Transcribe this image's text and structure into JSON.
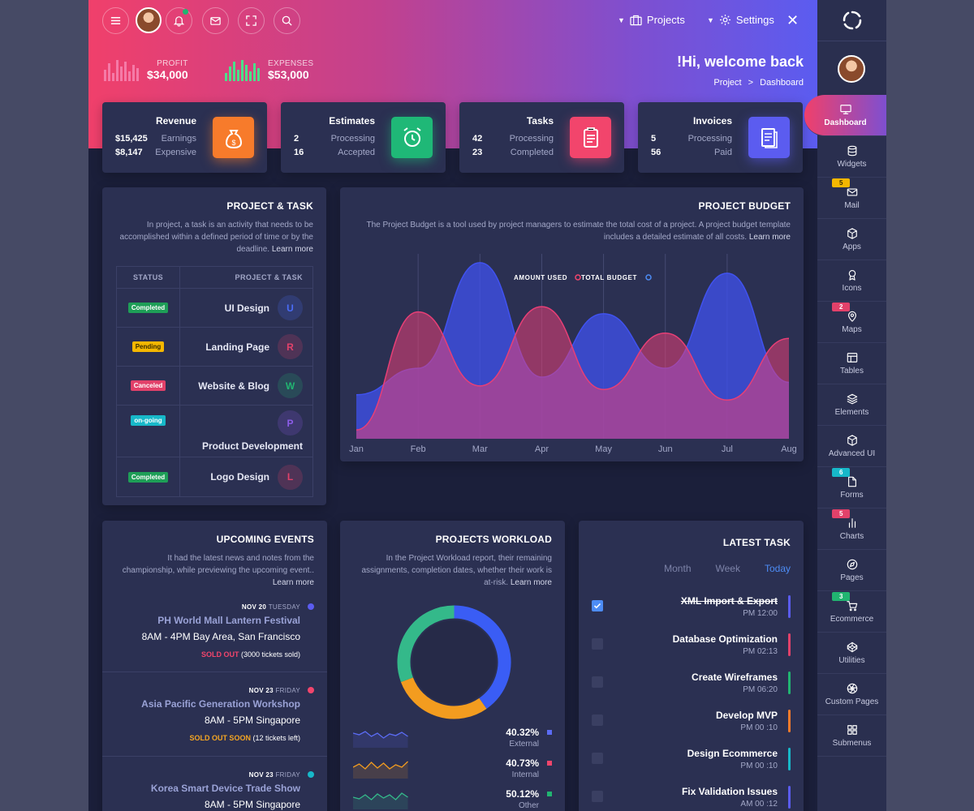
{
  "header": {
    "projects_label": "Projects",
    "settings_label": "Settings"
  },
  "stats": {
    "profit": {
      "label": "PROFIT",
      "value": "$34,000"
    },
    "expenses": {
      "label": "EXPENSES",
      "value": "$53,000"
    }
  },
  "welcome": {
    "title": "!Hi, welcome back",
    "crumb_1": "Project",
    "crumb_sep": ">",
    "crumb_2": "Dashboard"
  },
  "kpis": [
    {
      "title": "Revenue",
      "r1v": "$15,425",
      "r1l": "Earnings",
      "r2v": "$8,147",
      "r2l": "Expensive",
      "icon": "money-bag-icon",
      "color": "#f77b2b"
    },
    {
      "title": "Estimates",
      "r1v": "2",
      "r1l": "Processing",
      "r2v": "16",
      "r2l": "Accepted",
      "icon": "alarm-clock-icon",
      "color": "#1fb877"
    },
    {
      "title": "Tasks",
      "r1v": "42",
      "r1l": "Processing",
      "r2v": "23",
      "r2l": "Completed",
      "icon": "clipboard-icon",
      "color": "#f2456c"
    },
    {
      "title": "Invoices",
      "r1v": "5",
      "r1l": "Processing",
      "r2v": "56",
      "r2l": "Paid",
      "icon": "invoice-icon",
      "color": "#5b5cf0"
    }
  ],
  "project_task": {
    "title": "PROJECT & TASK",
    "desc": "In project, a task is an activity that needs to be accomplished within a defined period of time or by the deadline.",
    "learn": "Learn more",
    "col_status": "STATUS",
    "col_task": "PROJECT & TASK",
    "rows": [
      {
        "status": "Completed",
        "status_color": "#1e9e57",
        "name": "UI Design",
        "letter": "U",
        "letter_color": "#4a6cf7"
      },
      {
        "status": "Pending",
        "status_color": "#f5b700",
        "name": "Landing Page",
        "letter": "R",
        "letter_color": "#e2416a"
      },
      {
        "status": "Canceled",
        "status_color": "#e2416a",
        "name": "Website & Blog",
        "letter": "W",
        "letter_color": "#21b571"
      },
      {
        "status": "on-going",
        "status_color": "#17b8c9",
        "name": "Product Development",
        "letter": "P",
        "letter_color": "#8c5ce8"
      },
      {
        "status": "Completed",
        "status_color": "#1e9e57",
        "name": "Logo Design",
        "letter": "L",
        "letter_color": "#e2416a"
      }
    ]
  },
  "budget": {
    "title": "PROJECT BUDGET",
    "desc": "The Project Budget is a tool used by project managers to estimate the total cost of a project. A project budget template includes a detailed estimate of all costs.",
    "learn": "Learn more"
  },
  "chart_data": {
    "type": "area",
    "categories": [
      "Jan",
      "Feb",
      "Mar",
      "Apr",
      "May",
      "Jun",
      "Jul",
      "Aug"
    ],
    "series": [
      {
        "name": "TOTAL BUDGET",
        "color": "#4052f0",
        "values": [
          25,
          40,
          100,
          35,
          71,
          40,
          94,
          32
        ]
      },
      {
        "name": "AMOUNT USED",
        "color": "#e83f76",
        "values": [
          5,
          72,
          30,
          75,
          28,
          60,
          22,
          57
        ]
      }
    ],
    "ylim": [
      0,
      105
    ],
    "grid": true,
    "legend": "top-center"
  },
  "events": {
    "title": "UPCOMING EVENTS",
    "desc": "It had the latest news and notes from the championship, while previewing the upcoming event..",
    "learn": "Learn more",
    "items": [
      {
        "date": "NOV 20",
        "day": "TUESDAY",
        "name": "PH World Mall Lantern Festival",
        "time": "8AM - 4PM Bay Area, San Francisco",
        "status": "SOLD OUT",
        "status_color": "#f2456c",
        "note": "(3000 tickets sold)",
        "dot": "#5b5cf0"
      },
      {
        "date": "NOV 23",
        "day": "FRIDAY",
        "name": "Asia Pacific Generation Workshop",
        "time": "8AM - 5PM Singapore",
        "status": "SOLD OUT SOON",
        "status_color": "#f5a623",
        "note": "(12 tickets left)",
        "dot": "#f2456c"
      },
      {
        "date": "NOV 23",
        "day": "FRIDAY",
        "name": "Korea Smart Device Trade Show",
        "time": "8AM - 5PM Singapore",
        "status": "",
        "status_color": "",
        "note": "",
        "dot": "#17b8c9"
      }
    ]
  },
  "workload": {
    "title": "PROJECTS WORKLOAD",
    "desc": "In the Project Workload report, their remaining assignments, completion dates, whether their work is at-risk.",
    "learn": "Learn more",
    "donut": [
      {
        "value": 40.32,
        "color": "#3a5df5"
      },
      {
        "value": 29.0,
        "color": "#f39c1f"
      },
      {
        "value": 30.68,
        "color": "#34b98a"
      }
    ],
    "rows": [
      {
        "pct": "40.32%",
        "name": "External",
        "color": "#5b6cf5"
      },
      {
        "pct": "40.73%",
        "name": "Internal",
        "color": "#f2456c"
      },
      {
        "pct": "50.12%",
        "name": "Other",
        "color": "#21b571"
      }
    ]
  },
  "latest": {
    "title": "LATEST TASK",
    "tabs": [
      "Month",
      "Week",
      "Today"
    ],
    "tasks": [
      {
        "title": "XML Import & Export",
        "time": "PM 12:00",
        "done": true,
        "color": "#5b5cf0"
      },
      {
        "title": "Database Optimization",
        "time": "PM 02:13",
        "done": false,
        "color": "#e2416a"
      },
      {
        "title": "Create Wireframes",
        "time": "PM 06:20",
        "done": false,
        "color": "#21b571"
      },
      {
        "title": "Develop MVP",
        "time": "PM 00 :10",
        "done": false,
        "color": "#f77b2b"
      },
      {
        "title": "Design Ecommerce",
        "time": "PM 00 :10",
        "done": false,
        "color": "#17b8c9"
      },
      {
        "title": "Fix Validation Issues",
        "time": "AM 00 :12",
        "done": false,
        "color": "#5b5cf0"
      }
    ]
  },
  "sidebar": {
    "items": [
      {
        "label": "Dashboard",
        "icon": "monitor-icon",
        "badge": ""
      },
      {
        "label": "Widgets",
        "icon": "database-icon",
        "badge": ""
      },
      {
        "label": "Mail",
        "icon": "mail-icon",
        "badge": "5",
        "badge_color": "#f5b700"
      },
      {
        "label": "Apps",
        "icon": "cube-icon",
        "badge": ""
      },
      {
        "label": "Icons",
        "icon": "award-icon",
        "badge": ""
      },
      {
        "label": "Maps",
        "icon": "map-pin-icon",
        "badge": "2",
        "badge_color": "#e2416a"
      },
      {
        "label": "Tables",
        "icon": "table-icon",
        "badge": ""
      },
      {
        "label": "Elements",
        "icon": "layers-icon",
        "badge": ""
      },
      {
        "label": "Advanced UI",
        "icon": "box-icon",
        "badge": ""
      },
      {
        "label": "Forms",
        "icon": "file-icon",
        "badge": "6",
        "badge_color": "#17b8c9"
      },
      {
        "label": "Charts",
        "icon": "bar-chart-icon",
        "badge": "5",
        "badge_color": "#e2416a"
      },
      {
        "label": "Pages",
        "icon": "compass-icon",
        "badge": ""
      },
      {
        "label": "Ecommerce",
        "icon": "cart-icon",
        "badge": "3",
        "badge_color": "#21b571"
      },
      {
        "label": "Utilities",
        "icon": "codepen-icon",
        "badge": ""
      },
      {
        "label": "Custom Pages",
        "icon": "aperture-icon",
        "badge": ""
      },
      {
        "label": "Submenus",
        "icon": "grid-icon",
        "badge": ""
      }
    ]
  }
}
